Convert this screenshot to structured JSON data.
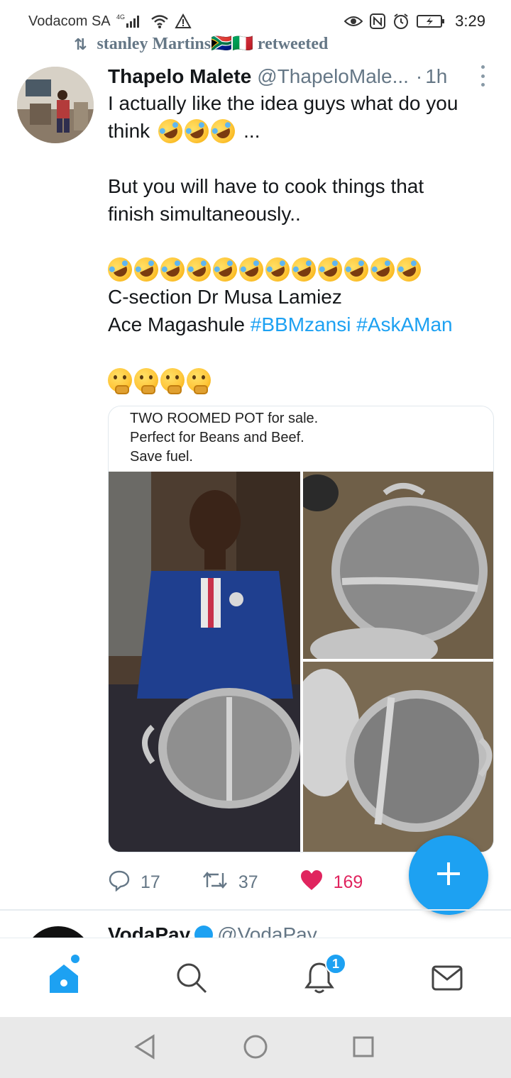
{
  "status_bar": {
    "carrier": "Vodacom SA",
    "network": "4G",
    "time": "3:29"
  },
  "retweet_context": {
    "text": "stanley Martins🇿🇦🇮🇹 retweeted"
  },
  "tweet": {
    "display_name": "Thapelo Malete",
    "handle": "@ThapeloMale...",
    "separator": "·",
    "time": "1h",
    "line1": "I actually like the idea guys what do you",
    "line2_prefix": "think",
    "line2_suffix": "...",
    "line3": "But you will have to cook things that",
    "line4": "finish simultaneously..",
    "line5": "C-section Dr Musa Lamiez",
    "line6_prefix": "Ace Magashule",
    "hashtag1": "#BBMzansi",
    "hashtag2": "#AskAMan",
    "emoji_rofl_count_line2": 3,
    "emoji_rofl_count_row": 12,
    "emoji_think_count": 4
  },
  "card": {
    "line1": "TWO ROOMED POT for sale.",
    "line2": "Perfect for Beans and Beef.",
    "line3": "Save fuel."
  },
  "actions": {
    "reply_count": "17",
    "retweet_count": "37",
    "like_count": "169"
  },
  "next_tweet": {
    "name": "VodaPay",
    "handle": "@VodaPay"
  },
  "bottom_nav": {
    "notification_badge": "1"
  },
  "colors": {
    "accent": "#1da1f2",
    "like": "#e0245e",
    "muted": "#657786"
  }
}
